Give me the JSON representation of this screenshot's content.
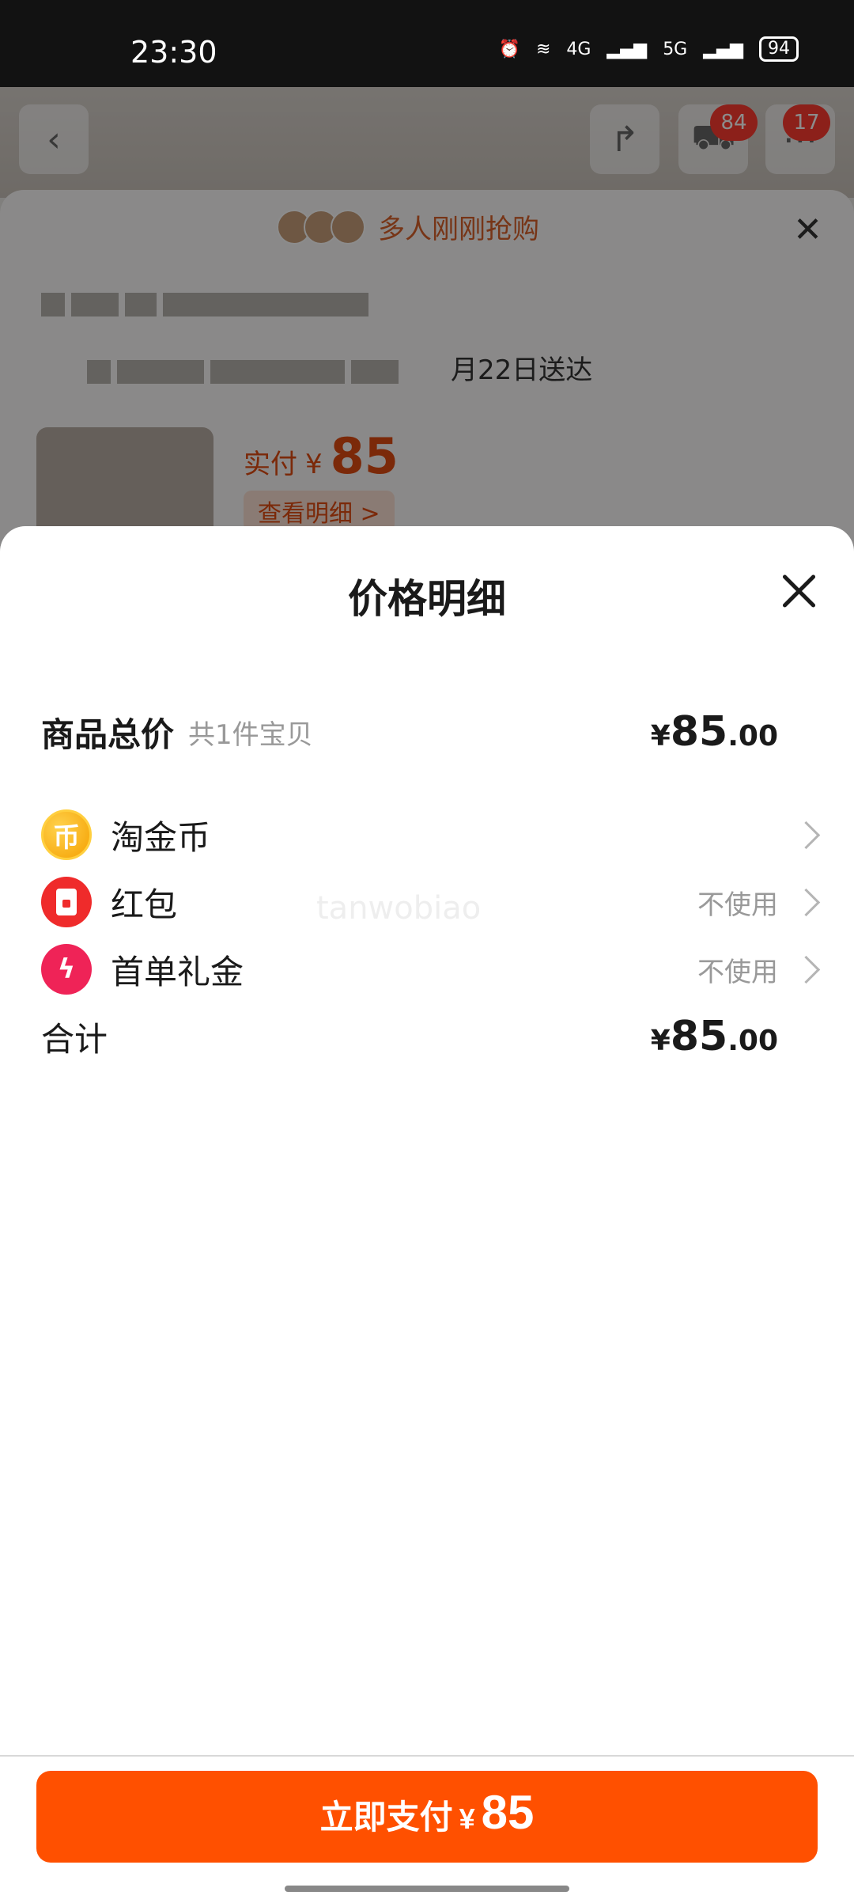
{
  "status_bar": {
    "time": "23:30",
    "network_1": "4G",
    "network_2": "5G",
    "battery": "94"
  },
  "background_page": {
    "cart_badge": "84",
    "msg_badge": "17",
    "banner_text": "多人刚刚抢购",
    "delivery_text": "月22日送达",
    "actual_pay_label": "实付",
    "actual_pay_symbol": "¥",
    "actual_pay_amount": "85",
    "view_detail": "查看明细 >"
  },
  "sheet": {
    "title": "价格明细",
    "rows": [
      {
        "label": "商品总价",
        "sub": "共1件宝贝",
        "price_symbol": "¥",
        "price_int": "85",
        "price_dec": ".00"
      },
      {
        "label": "淘金币",
        "icon": "coin-icon",
        "icon_glyph": "币"
      },
      {
        "label": "红包",
        "icon": "red-packet-icon",
        "status": "不使用"
      },
      {
        "label": "首单礼金",
        "icon": "lightning-icon",
        "status": "不使用"
      }
    ],
    "total": {
      "label": "合计",
      "price_symbol": "¥",
      "price_int": "85",
      "price_dec": ".00"
    },
    "watermark": "tanwobiao"
  },
  "pay_button": {
    "label": "立即支付",
    "symbol": "¥",
    "amount": "85"
  },
  "colors": {
    "accent": "#ff5000",
    "coin": "#f5a000",
    "red_packet": "#ef2b2b",
    "bolt": "#ef2357"
  }
}
